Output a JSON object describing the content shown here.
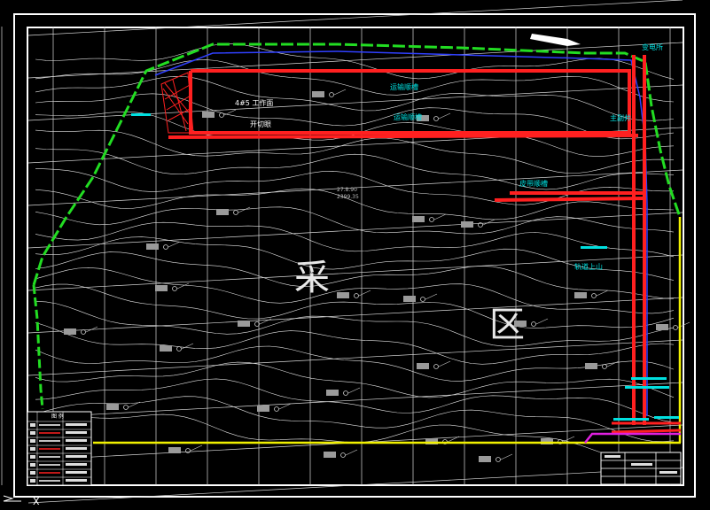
{
  "drawing": {
    "colors": {
      "background": "#000000",
      "frame": "#ffffff",
      "grid": "#d8d8d8",
      "contour": "#e6e6e6",
      "boundary_green": "#22dd22",
      "roadway_red": "#ff2020",
      "label_cyan": "#00e0e0",
      "limit_yellow": "#f0f000",
      "blue_line": "#3040ff",
      "magenta": "#e020e0",
      "tag_gray": "#9a9a9a"
    },
    "zone_chars": [
      "采",
      "区"
    ],
    "labels": {
      "face": "4#5 工作面",
      "cut_eye": "开切眼",
      "return_lane": "运输顺槽",
      "haul_lane": "运输顺槽",
      "belt_lane": "皮带顺槽",
      "track_lane": "轨道上山",
      "top_right": "变电所",
      "right_mid": "主副井",
      "elev_a": "27.8.90",
      "elev_b": "2399.35"
    },
    "legend_title": "图 例",
    "axis_marker": "X"
  }
}
